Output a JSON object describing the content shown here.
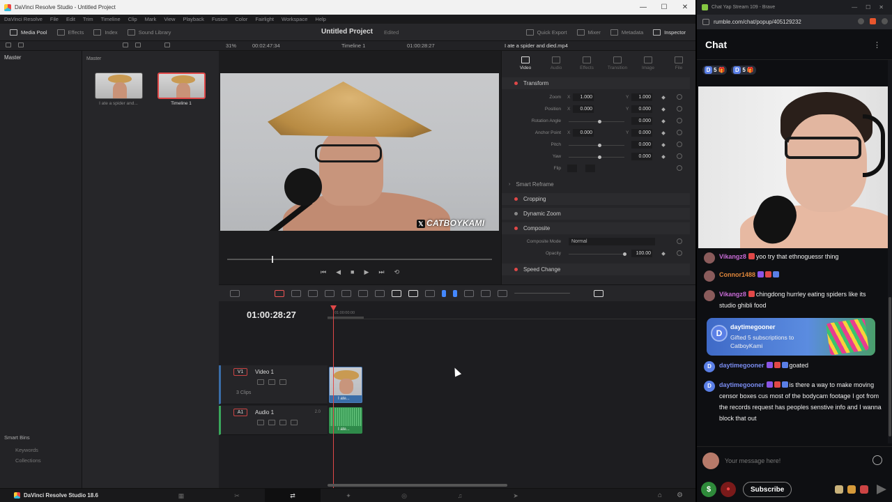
{
  "resolve": {
    "window_title": "DaVinci Resolve Studio - Untitled Project",
    "menu": [
      "DaVinci Resolve",
      "File",
      "Edit",
      "Trim",
      "Timeline",
      "Clip",
      "Mark",
      "View",
      "Playback",
      "Fusion",
      "Color",
      "Fairlight",
      "Workspace",
      "Help"
    ],
    "toolbar_left": [
      {
        "label": "Media Pool",
        "active": true,
        "icon": "media-pool-icon"
      },
      {
        "label": "Effects",
        "active": false,
        "icon": "effects-icon"
      },
      {
        "label": "Index",
        "active": false,
        "icon": "index-icon"
      },
      {
        "label": "Sound Library",
        "active": false,
        "icon": "sound-library-icon"
      }
    ],
    "project_title": "Untitled Project",
    "project_status": "Edited",
    "toolbar_right": [
      {
        "label": "Quick Export",
        "active": false,
        "icon": "export-icon"
      },
      {
        "label": "Mixer",
        "active": false,
        "icon": "mixer-icon"
      },
      {
        "label": "Metadata",
        "active": false,
        "icon": "metadata-icon"
      },
      {
        "label": "Inspector",
        "active": true,
        "icon": "inspector-icon"
      }
    ],
    "viewer_zoom": "31%",
    "viewer_timecode_left": "00:02:47:34",
    "timeline_name": "Timeline 1",
    "viewer_timecode_right": "01:00:28:27",
    "clip_name": "I ate a spider and died.mp4",
    "left_panel": {
      "master": "Master",
      "smart_bins": "Smart Bins",
      "keywords": "Keywords",
      "collections": "Collections"
    },
    "bin_label": "Master",
    "bin_items": [
      {
        "label": "I ate a spider and...",
        "selected": false
      },
      {
        "label": "Timeline 1",
        "selected": true
      }
    ],
    "watermark": "CATBOYKAMI",
    "inspector": {
      "tabs": [
        {
          "label": "Video",
          "active": true
        },
        {
          "label": "Audio",
          "active": false
        },
        {
          "label": "Effects",
          "active": false
        },
        {
          "label": "Transition",
          "active": false
        },
        {
          "label": "Image",
          "active": false
        },
        {
          "label": "File",
          "active": false
        }
      ],
      "transform": "Transform",
      "zoom": {
        "label": "Zoom",
        "x": "1.000",
        "y": "1.000"
      },
      "position": {
        "label": "Position",
        "x": "0.000",
        "y": "0.000"
      },
      "rotation": {
        "label": "Rotation Angle",
        "value": "0.000"
      },
      "anchor": {
        "label": "Anchor Point",
        "x": "0.000",
        "y": "0.000"
      },
      "pitch": {
        "label": "Pitch",
        "value": "0.000"
      },
      "yaw": {
        "label": "Yaw",
        "value": "0.000"
      },
      "flip": {
        "label": "Flip"
      },
      "smart_reframe": "Smart Reframe",
      "cropping": "Cropping",
      "dynamic_zoom": "Dynamic Zoom",
      "composite": "Composite",
      "composite_mode": {
        "label": "Composite Mode",
        "value": "Normal"
      },
      "opacity": {
        "label": "Opacity",
        "value": "100.00"
      },
      "speed_change": "Speed Change",
      "axis_x": "X",
      "axis_y": "Y"
    },
    "timeline": {
      "timecode": "01:00:28:27",
      "ruler_tc": "01:00:00:00",
      "video_track": {
        "id": "V1",
        "name": "Video 1",
        "clips": "3 Clips",
        "clip_label": "I ate..."
      },
      "audio_track": {
        "id": "A1",
        "name": "Audio 1",
        "channels": "2.0",
        "clip_label": "I ate..."
      }
    },
    "brand": "DaVinci Resolve Studio 18.6"
  },
  "chat": {
    "browser_title": "Chat Yap Stream 109 - Brave",
    "url": "rumble.com/chat/popup/405129232",
    "title": "Chat",
    "gift_chips": [
      {
        "letter": "D",
        "count": "5"
      },
      {
        "letter": "D",
        "count": "5"
      }
    ],
    "messages": [
      {
        "user": "Vikangz8",
        "color": "#c86bd6",
        "text": "yoo try that ethnoguessr thing",
        "badges": [
          "#e04848"
        ]
      },
      {
        "user": "Connor1488",
        "color": "#e0873a",
        "text": "",
        "badges": [
          "#8a55e6",
          "#e04848",
          "#5a7fe6"
        ]
      },
      {
        "user": "Vikangz8",
        "color": "#c86bd6",
        "text": "chingdong hurrley eating spiders like its studio ghibli food",
        "badges": [
          "#e04848"
        ]
      },
      {
        "user": "daytimegooner",
        "color": "#7a8cf0",
        "text": "goated",
        "badges": [
          "#8a55e6",
          "#e04848",
          "#5a7fe6"
        ]
      },
      {
        "user": "daytimegooner",
        "color": "#7a8cf0",
        "text": "is there a way to make moving censor boxes cus most of the bodycam footage I got from the records request has peoples senstive info and I wanna block that out",
        "badges": [
          "#8a55e6",
          "#e04848",
          "#5a7fe6"
        ]
      }
    ],
    "gift": {
      "user": "daytimegooner",
      "text": "Gifted 5 subscriptions to CatboyKami",
      "letter": "D"
    },
    "input_placeholder": "Your message here!",
    "subscribe_label": "Subscribe",
    "money_icon": "$"
  }
}
